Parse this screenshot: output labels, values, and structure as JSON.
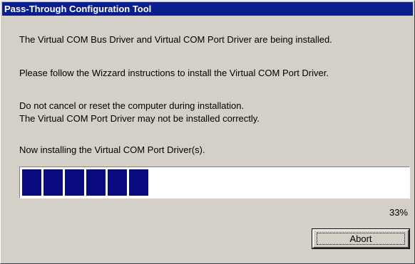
{
  "window": {
    "title": "Pass-Through Configuration Tool"
  },
  "messages": {
    "line1": "The Virtual COM Bus Driver and Virtual COM Port Driver are being installed.",
    "line2": "Please follow the Wizzard instructions to install the Virtual COM Port Driver.",
    "line3": "Do not cancel or reset the computer during installation.",
    "line4": "The Virtual COM Port Driver may not be installed correctly.",
    "status": "Now installing the Virtual COM Port Driver(s)."
  },
  "progress": {
    "fraction": 0.33,
    "label": "33%",
    "fill_color": "#0a0a80"
  },
  "buttons": {
    "abort_label": "Abort"
  },
  "colors": {
    "titlebar": "#0a1f8f",
    "face": "#d4d0c8"
  }
}
